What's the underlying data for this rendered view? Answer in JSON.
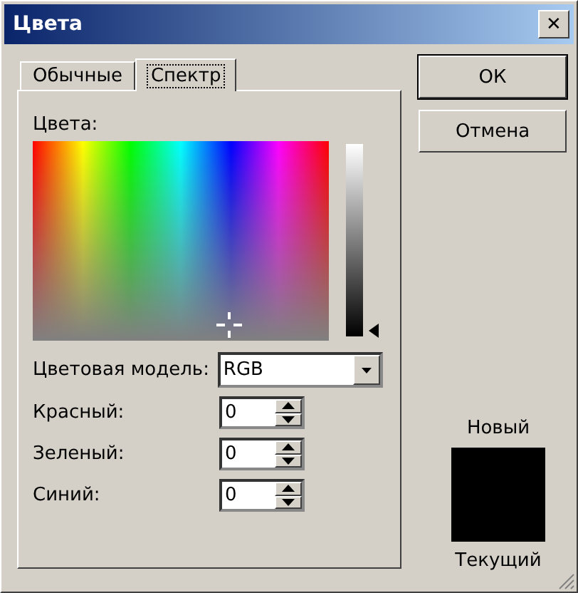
{
  "window": {
    "title": "Цвета",
    "close": "✕"
  },
  "tabs": [
    {
      "label": "Обычные",
      "selected": false
    },
    {
      "label": "Спектр",
      "selected": true
    }
  ],
  "spectrum": {
    "label": "Цвета:"
  },
  "color_model": {
    "label": "Цветовая модель:",
    "value": "RGB"
  },
  "channels": [
    {
      "label": "Красный:",
      "value": "0"
    },
    {
      "label": "Зеленый:",
      "value": "0"
    },
    {
      "label": "Синий:",
      "value": "0"
    }
  ],
  "buttons": [
    "ОК",
    "Отмена"
  ],
  "preview": {
    "new_label": "Новый",
    "current_label": "Текущий"
  }
}
